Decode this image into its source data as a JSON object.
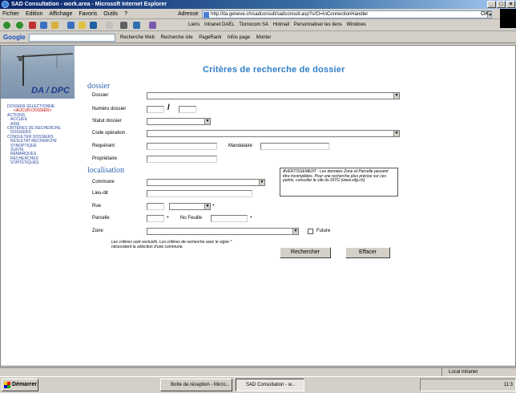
{
  "window": {
    "title": "SAD Consultation - work.area - Microsoft Internet Explorer"
  },
  "menu": [
    "Fichier",
    "Edition",
    "Affichage",
    "Favoris",
    "Outils",
    "?"
  ],
  "address": {
    "label": "Adresse",
    "url": "http://ita.geneve.ch/sadconsult/sadconsult.asp?s/Cl=InConnectionHandler",
    "go_label": "OK"
  },
  "links_bar": [
    "Liens",
    "Intranet DAEL",
    "Ticinocom SA",
    "Hotmail",
    "Personnaliser les liens",
    "Windows"
  ],
  "google_bar": {
    "brand": "Google",
    "tools": [
      "Recherche Web",
      "Recherche site",
      "PageRank",
      "Infos page",
      "Monter"
    ]
  },
  "sidebar": {
    "logo": "DA / DPC",
    "nav": [
      {
        "text": "Dossier sélectionné",
        "style": "normal"
      },
      {
        "text": "<aucun dossier>",
        "style": "red"
      },
      {
        "text": "Actions",
        "style": "normal"
      },
      {
        "text": "Accueil",
        "style": "sub"
      },
      {
        "text": "Aide",
        "style": "sub"
      },
      {
        "text": "Critères de recherche",
        "style": "normal"
      },
      {
        "text": "Dossiers",
        "style": "sub"
      },
      {
        "text": "Consulter dossiers",
        "style": "normal"
      },
      {
        "text": "Résultat recherche",
        "style": "sub"
      },
      {
        "text": "Synoptique",
        "style": "sub"
      },
      {
        "text": "Suivis",
        "style": "sub"
      },
      {
        "text": "Remarques",
        "style": "sub"
      },
      {
        "text": "Recherches",
        "style": "sub"
      },
      {
        "text": "Statistiques",
        "style": "sub"
      }
    ]
  },
  "form": {
    "title": "Critères de recherche de dossier",
    "section_dossier": "dossier",
    "section_localisation": "localisation",
    "labels": {
      "dossier": "Dossier",
      "numero_dossier": "Numéro dossier",
      "numero_sep": "/",
      "statut_dossier": "Statut dossier",
      "code_operation": "Code opération",
      "requerant": "Requérant",
      "mandataire": "Mandataire",
      "proprietaire": "Propriétaire",
      "commune": "Commune",
      "lieu_dit": "Lieu-dit",
      "rue": "Rue",
      "parcelle": "Parcelle",
      "no_feuille": "No Feuille",
      "zone": "Zone",
      "future": "Future"
    },
    "values": {
      "dossier": "",
      "numero_dossier_1": "",
      "numero_dossier_2": "",
      "statut_dossier": "",
      "code_operation": "",
      "requerant": "",
      "mandataire": "",
      "proprietaire": "",
      "commune": "",
      "lieu_dit": "",
      "rue_numero": "",
      "rue_nom": "",
      "parcelle": "",
      "no_feuille": "",
      "zone": "",
      "future_checked": false
    },
    "required_mark": "*",
    "warning": "AVERTISSEMENT : Les données Zone et Parcelle peuvent être incomplètes. Pour une recherche plus précise sur ces points, consulter le site du DITG (www.sitg.ch)",
    "note": "Les critères sont exclusifs. Les critères de recherche avec le signe * nécessitent la sélection d'une commune.",
    "search_button": "Rechercher",
    "clear_button": "Effacer"
  },
  "status": {
    "left": "",
    "zone": "Local intranet"
  },
  "taskbar": {
    "start": "Démarrer",
    "tasks": [
      "Boîte de réception - Micro...",
      "SAD Consultation - w..."
    ],
    "clock": "11:3"
  }
}
